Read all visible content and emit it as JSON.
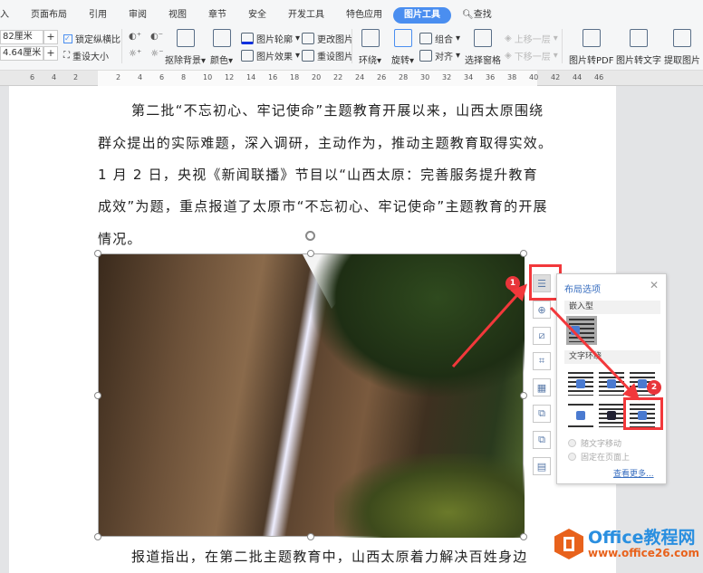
{
  "ribbon": {
    "tabs": [
      "入",
      "页面布局",
      "引用",
      "审阅",
      "视图",
      "章节",
      "安全",
      "开发工具",
      "特色应用",
      "图片工具",
      "查找"
    ],
    "width_value": "82厘米",
    "height_value": "4.64厘米",
    "lock_ratio": "锁定纵横比",
    "reset_size": "重设大小",
    "remove_bg": "抠除背景",
    "color": "颜色",
    "outline": "图片轮廓",
    "effect": "图片效果",
    "change_pic": "更改图片",
    "reset_pic": "重设图片",
    "wrap": "环绕",
    "rotate": "旋转",
    "group": "组合",
    "align": "对齐",
    "select_pane": "选择窗格",
    "bring_forward": "上移一层",
    "send_backward": "下移一层",
    "to_pdf": "图片转PDF",
    "to_text": "图片转文字",
    "extract": "提取图片"
  },
  "ruler": {
    "left_ticks": [
      "6",
      "4",
      "2"
    ],
    "right_ticks": [
      "2",
      "4",
      "6",
      "8",
      "10",
      "12",
      "14",
      "16",
      "18",
      "20",
      "22",
      "24",
      "26",
      "28",
      "30",
      "32",
      "34",
      "36",
      "38",
      "40",
      "42",
      "44",
      "46"
    ]
  },
  "document": {
    "lines": [
      "第二批“不忘初心、牢记使命”主题教育开展以来，山西太原围绕",
      "群众提出的实际难题，深入调研，主动作为，推动主题教育取得实效。",
      "1 月 2 日，央视《新闻联播》节目以“山西太原：完善服务提升教育",
      "成效”为题，重点报道了太原市“不忘初心、牢记使命”主题教育的开展",
      "情况。"
    ],
    "bottom_line": "报道指出，在第二批主题教育中，山西太原着力解决百姓身边"
  },
  "popup": {
    "title": "布局选项",
    "inline": "嵌入型",
    "wrapping": "文字环绕",
    "move_with_text": "随文字移动",
    "fix_on_page": "固定在页面上",
    "see_more": "查看更多..."
  },
  "badges": [
    "1",
    "2"
  ],
  "watermark": {
    "name": "Office教程网",
    "url": "www.office26.com"
  },
  "colors": {
    "accent": "#4a8ef0",
    "highlight": "#f2383b",
    "logo": "#e8621c"
  }
}
